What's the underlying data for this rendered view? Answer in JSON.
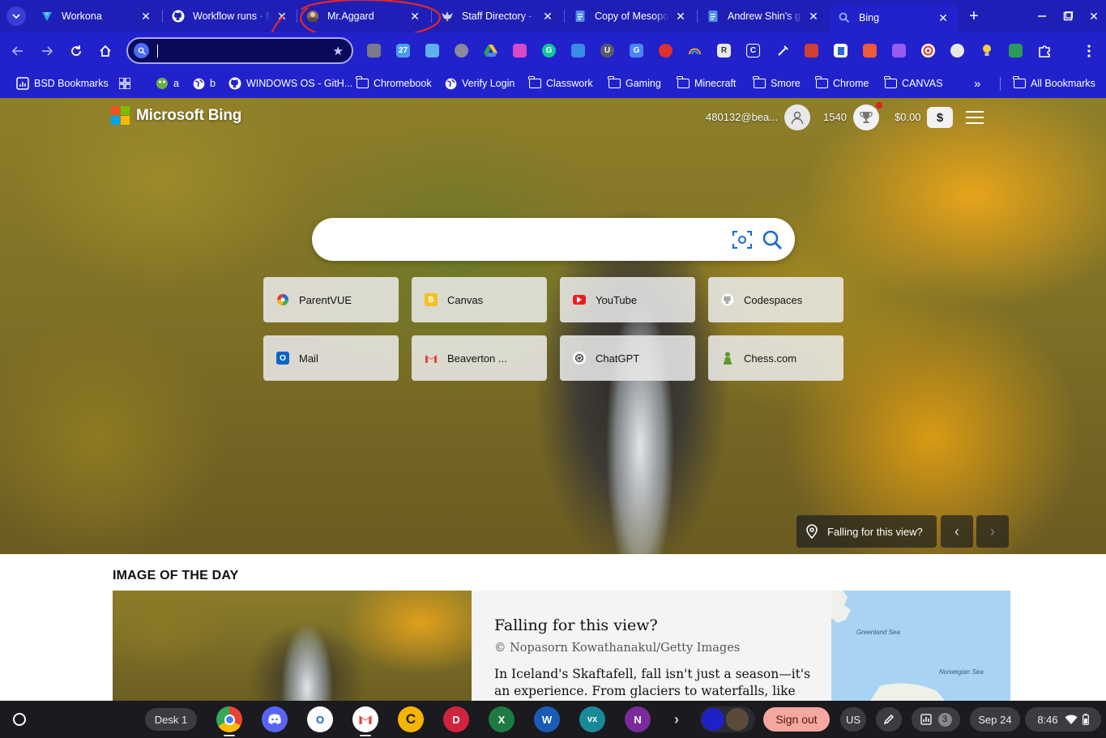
{
  "browser": {
    "tabs": [
      {
        "title": "Workona",
        "icon": "workona-icon"
      },
      {
        "title": "Workflow runs · M",
        "icon": "github-icon"
      },
      {
        "title": "Mr.Aggard",
        "icon": "avatar-icon"
      },
      {
        "title": "Staff Directory - B",
        "icon": "eagle-icon"
      },
      {
        "title": "Copy of Mesopot",
        "icon": "docs-icon"
      },
      {
        "title": "Andrew Shin's ga",
        "icon": "docs-icon"
      },
      {
        "title": "Bing",
        "icon": "search-icon",
        "active": true
      }
    ],
    "omnibox_value": "",
    "bookmarks": [
      {
        "label": "BSD Bookmarks",
        "icon": "grid-icon"
      },
      {
        "label": "",
        "icon": "apps-icon"
      },
      {
        "label": "a",
        "icon": "frog-icon"
      },
      {
        "label": "b",
        "icon": "globe-icon"
      },
      {
        "label": "WINDOWS OS - GitH...",
        "icon": "github-icon"
      },
      {
        "label": "Chromebook",
        "icon": "folder-icon"
      },
      {
        "label": "Verify Login",
        "icon": "globe-icon"
      },
      {
        "label": "Classwork",
        "icon": "folder-icon"
      },
      {
        "label": "Gaming",
        "icon": "folder-icon"
      },
      {
        "label": "Minecraft",
        "icon": "folder-icon"
      },
      {
        "label": "Smore",
        "icon": "folder-icon"
      },
      {
        "label": "Chrome",
        "icon": "folder-icon"
      },
      {
        "label": "CANVAS",
        "icon": "folder-icon"
      }
    ],
    "all_bookmarks": "All Bookmarks"
  },
  "bing": {
    "logo_text": "Microsoft Bing",
    "account": "480132@bea...",
    "points": "1540",
    "balance": "$0.00",
    "dollar_symbol": "$",
    "search_value": "",
    "tiles": [
      {
        "label": "ParentVUE",
        "icon": "parentvue-icon"
      },
      {
        "label": "Canvas",
        "icon": "canvas-icon"
      },
      {
        "label": "YouTube",
        "icon": "youtube-icon"
      },
      {
        "label": "Codespaces",
        "icon": "github-icon"
      },
      {
        "label": "Mail",
        "icon": "outlook-icon"
      },
      {
        "label": "Beaverton ...",
        "icon": "gmail-icon"
      },
      {
        "label": "ChatGPT",
        "icon": "chatgpt-icon"
      },
      {
        "label": "Chess.com",
        "icon": "chess-icon"
      }
    ],
    "caption": "Falling for this view?",
    "iotd": {
      "heading": "IMAGE OF THE DAY",
      "title": "Falling for this view?",
      "credit": "© Nopasorn Kowathanakul/Getty Images",
      "description": "In Iceland's Skaftafell, fall isn't just a season—it's an experience. From glaciers to waterfalls, like the one",
      "map_labels": [
        "Greenland Sea",
        "Norwegian Sea"
      ]
    }
  },
  "shelf": {
    "desk": "Desk 1",
    "signout": "Sign out",
    "ime": "US",
    "notifications": "3",
    "date": "Sep 24",
    "time": "8:46"
  }
}
